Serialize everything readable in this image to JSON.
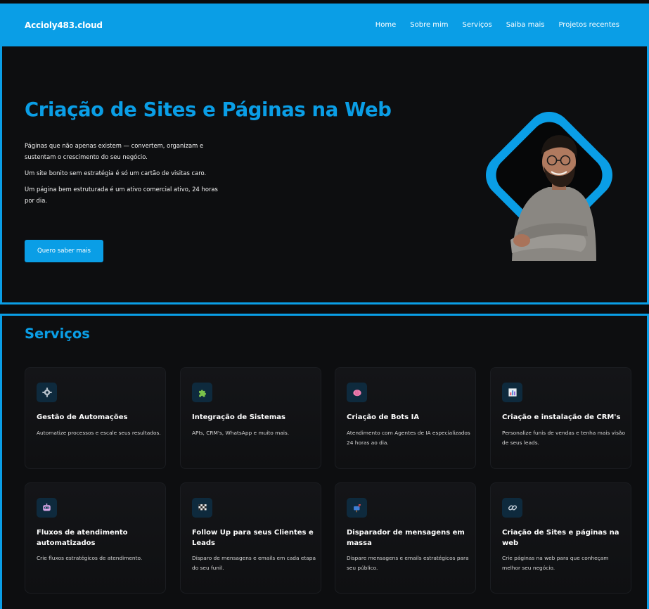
{
  "header": {
    "logo": "Accioly483.cloud",
    "nav": [
      {
        "label": "Home"
      },
      {
        "label": "Sobre mim"
      },
      {
        "label": "Serviços"
      },
      {
        "label": "Saiba mais"
      },
      {
        "label": "Projetos recentes"
      }
    ]
  },
  "hero": {
    "title": "Criação de Sites e Páginas na Web",
    "paragraphs": [
      "Páginas que não apenas existem — convertem, organizam e sustentam o crescimento do seu negócio.",
      "Um site bonito sem estratégia é só um cartão de visitas caro.",
      "Um página bem estruturada é um ativo comercial ativo, 24 horas por dia."
    ],
    "cta_label": "Quero saber mais"
  },
  "services": {
    "title": "Serviços",
    "cards": [
      {
        "icon": "gear-icon",
        "title": "Gestão de Automações",
        "description": "Automatize processos e escale seus resultados."
      },
      {
        "icon": "puzzle-icon",
        "title": "Integração de Sistemas",
        "description": "APIs, CRM's, WhatsApp e muito mais."
      },
      {
        "icon": "brain-icon",
        "title": "Criação de Bots IA",
        "description": "Atendimento com Agentes de IA especializados 24 horas ao dia."
      },
      {
        "icon": "chart-icon",
        "title": "Criação e instalação de CRM's",
        "description": "Personalize funis de vendas e tenha mais visão de seus leads."
      },
      {
        "icon": "robot-icon",
        "title": "Fluxos de atendimento automatizados",
        "description": "Crie fluxos estratégicos de atendimento."
      },
      {
        "icon": "checkered-flag-icon",
        "title": "Follow Up para seus Clientes e Leads",
        "description": "Disparo de mensagens e emails em cada etapa do seu funil."
      },
      {
        "icon": "mailbox-icon",
        "title": "Disparador de mensagens em massa",
        "description": "Dispare mensagens e emails estratégicos para seu público."
      },
      {
        "icon": "link-icon",
        "title": "Criação de Sites e páginas na web",
        "description": "Crie páginas na web para que conheçam melhor seu negócio."
      }
    ]
  },
  "colors": {
    "accent": "#0a9ee6",
    "background": "#0d0e10",
    "card": "#141518"
  }
}
